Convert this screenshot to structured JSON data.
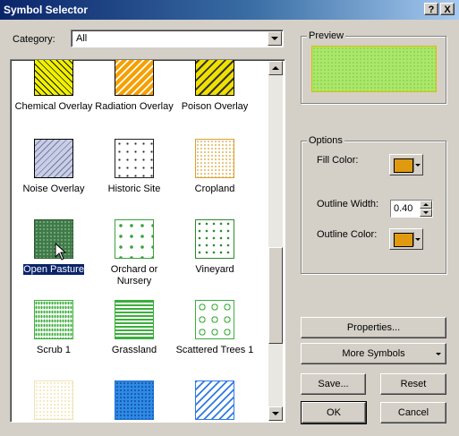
{
  "window": {
    "title": "Symbol Selector",
    "help_glyph": "?",
    "close_glyph": "X"
  },
  "category": {
    "label": "Category:",
    "value": "All"
  },
  "symbols": [
    {
      "label": "Chemical Overlay",
      "icon": "chemical-overlay-swatch"
    },
    {
      "label": "Radiation Overlay",
      "icon": "radiation-overlay-swatch"
    },
    {
      "label": "Poison Overlay",
      "icon": "poison-overlay-swatch"
    },
    {
      "label": "Noise Overlay",
      "icon": "noise-overlay-swatch"
    },
    {
      "label": "Historic Site",
      "icon": "historic-site-swatch"
    },
    {
      "label": "Cropland",
      "icon": "cropland-swatch"
    },
    {
      "label": "Open Pasture",
      "icon": "open-pasture-swatch",
      "selected": true
    },
    {
      "label": "Orchard or Nursery",
      "icon": "orchard-swatch"
    },
    {
      "label": "Vineyard",
      "icon": "vineyard-swatch"
    },
    {
      "label": "Scrub 1",
      "icon": "scrub-swatch"
    },
    {
      "label": "Grassland",
      "icon": "grassland-swatch"
    },
    {
      "label": "Scattered Trees 1",
      "icon": "scattered-trees-swatch"
    },
    {
      "label": "",
      "icon": "pale-dots-swatch"
    },
    {
      "label": "",
      "icon": "blue-dots-swatch"
    },
    {
      "label": "",
      "icon": "blue-hatch-swatch"
    }
  ],
  "preview": {
    "legend": "Preview",
    "fill": "#a9e86a"
  },
  "options": {
    "legend": "Options",
    "fill_color_label": "Fill Color:",
    "fill_color": "#e09a10",
    "outline_width_label": "Outline Width:",
    "outline_width": "0.40",
    "outline_color_label": "Outline Color:",
    "outline_color": "#e09a10"
  },
  "buttons": {
    "properties": "Properties...",
    "more_symbols": "More Symbols",
    "save": "Save...",
    "reset": "Reset",
    "ok": "OK",
    "cancel": "Cancel"
  }
}
